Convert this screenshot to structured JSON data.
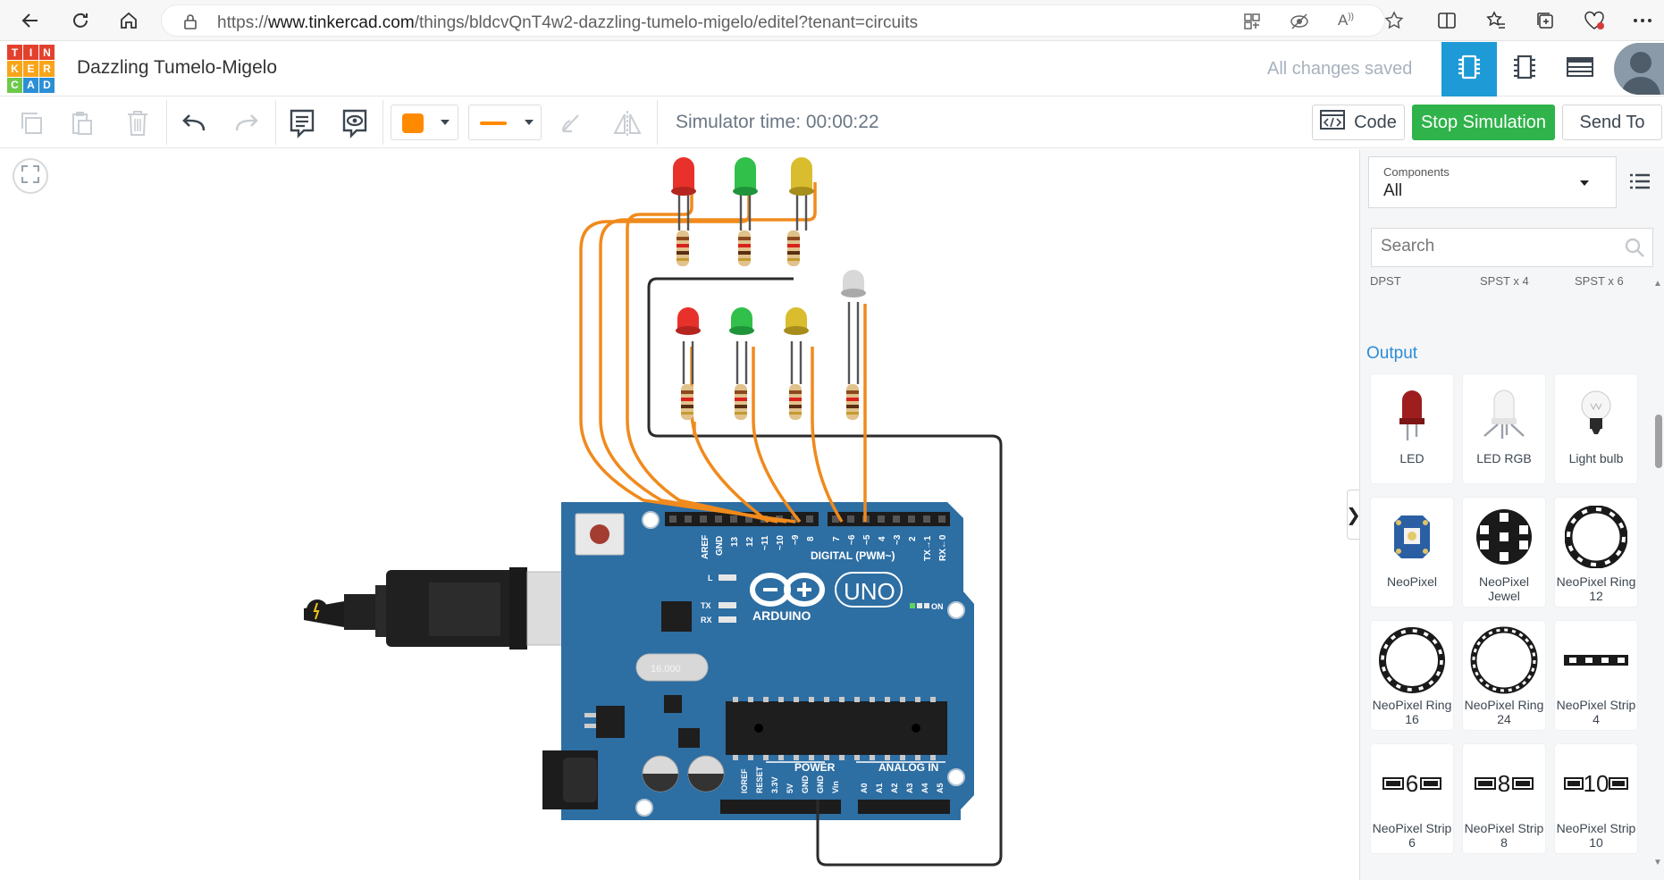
{
  "browser": {
    "url_prefix": "https://",
    "url_host": "www.tinkercad.com",
    "url_path": "/things/bldcvQnT4w2-dazzling-tumelo-migelo/editel?tenant=circuits"
  },
  "app": {
    "logo_letters": [
      "T",
      "I",
      "N",
      "K",
      "E",
      "R",
      "C",
      "A",
      "D"
    ],
    "logo_colors": [
      "#e2412e",
      "#e2412e",
      "#e2412e",
      "#f8a51b",
      "#f8a51b",
      "#f8a51b",
      "#6dc94b",
      "#2b8fd6",
      "#2b8fd6"
    ],
    "design_title": "Dazzling Tumelo-Migelo",
    "save_status": "All changes saved",
    "accent_color": "#1e9ad6"
  },
  "toolbar": {
    "simulator_time": "Simulator time: 00:00:22",
    "code_label": "Code",
    "stop_label": "Stop Simulation",
    "send_to_label": "Send To",
    "fill_color": "#ff8a00",
    "wire_color": "#ff8a00",
    "stop_color": "#2fb34a"
  },
  "panel": {
    "components_label": "Components",
    "components_value": "All",
    "search_placeholder": "Search",
    "partial_labels": [
      "DPST",
      "SPST x 4",
      "SPST x 6"
    ],
    "output_heading": "Output",
    "cards": [
      {
        "label": "LED",
        "icon": "led-icon"
      },
      {
        "label": "LED RGB",
        "icon": "led-rgb-icon"
      },
      {
        "label": "Light bulb",
        "icon": "light-bulb-icon"
      },
      {
        "label": "NeoPixel",
        "icon": "neopixel-icon"
      },
      {
        "label": "NeoPixel Jewel",
        "icon": "neopixel-jewel-icon"
      },
      {
        "label": "NeoPixel Ring 12",
        "icon": "neopixel-ring-12-icon"
      },
      {
        "label": "NeoPixel Ring 16",
        "icon": "neopixel-ring-16-icon"
      },
      {
        "label": "NeoPixel Ring 24",
        "icon": "neopixel-ring-24-icon"
      },
      {
        "label": "NeoPixel Strip 4",
        "icon": "neopixel-strip-4-icon"
      },
      {
        "label": "NeoPixel Strip 6",
        "icon": "neopixel-strip-6-icon",
        "thumb_text": "6"
      },
      {
        "label": "NeoPixel Strip 8",
        "icon": "neopixel-strip-8-icon",
        "thumb_text": "8"
      },
      {
        "label": "NeoPixel Strip 10",
        "icon": "neopixel-strip-10-icon",
        "thumb_text": "10"
      }
    ]
  },
  "circuit": {
    "board_color": "#2d6ea3",
    "board_logo": "ARDUINO",
    "board_model": "UNO",
    "digital_label": "DIGITAL (PWM~)",
    "power_label": "POWER",
    "analog_label": "ANALOG IN",
    "on_label": "ON",
    "l_label": "L",
    "tx_label": "TX",
    "rx_label": "RX",
    "crystal_text": "16.000",
    "digital_pins": [
      "AREF",
      "GND",
      "13",
      "12",
      "~11",
      "~10",
      "~9",
      "8",
      "7",
      "~6",
      "~5",
      "4",
      "~3",
      "2",
      "TX→1",
      "RX←0"
    ],
    "power_pins": [
      "IOREF",
      "RESET",
      "3.3V",
      "5V",
      "GND",
      "GND",
      "Vin"
    ],
    "analog_pins": [
      "A0",
      "A1",
      "A2",
      "A3",
      "A4",
      "A5"
    ],
    "led_colors": {
      "red": "#e8312b",
      "green": "#31c04a",
      "yellow": "#d9bd2e",
      "white": "#d8d8d8"
    },
    "wire_orange": "#f08a1c",
    "wire_black": "#2b2b2b"
  }
}
